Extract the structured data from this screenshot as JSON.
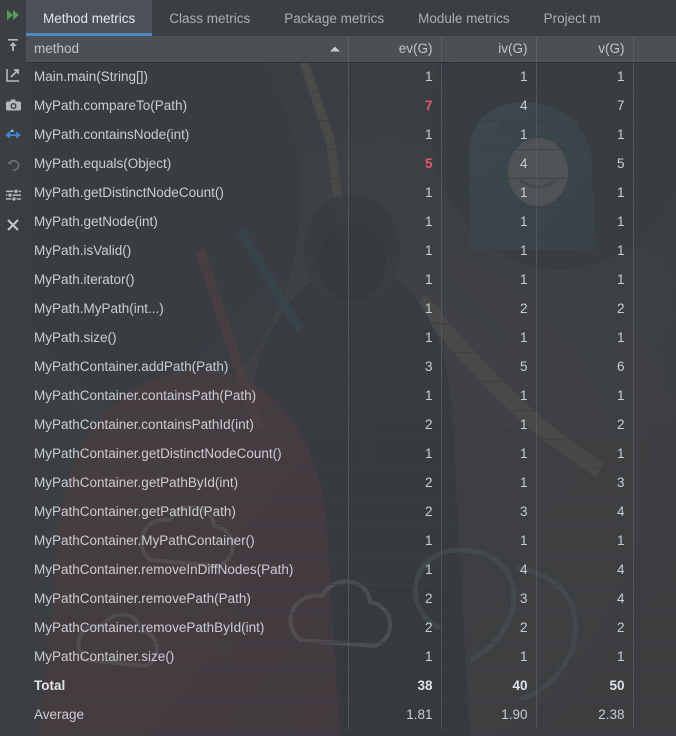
{
  "rail": {
    "items": [
      {
        "name": "fast-forward-icon",
        "title": "Expand"
      },
      {
        "name": "collapse-up-icon",
        "title": "Collapse"
      },
      {
        "name": "export-icon",
        "title": "Export"
      },
      {
        "name": "camera-icon",
        "title": "Snapshot"
      },
      {
        "name": "diff-arrows-icon",
        "title": "Compare"
      },
      {
        "name": "undo-icon",
        "title": "Undo"
      },
      {
        "name": "settings-sliders-icon",
        "title": "Settings"
      },
      {
        "name": "close-icon",
        "title": "Close"
      }
    ]
  },
  "tabs": [
    {
      "label": "Method metrics",
      "active": true
    },
    {
      "label": "Class metrics",
      "active": false
    },
    {
      "label": "Package metrics",
      "active": false
    },
    {
      "label": "Module metrics",
      "active": false
    },
    {
      "label": "Project m",
      "active": false
    }
  ],
  "table": {
    "columns": [
      "method",
      "ev(G)",
      "iv(G)",
      "v(G)"
    ],
    "sort": {
      "column": "method",
      "direction": "ascending"
    },
    "rows": [
      {
        "method": "Main.main(String[])",
        "ev": "1",
        "iv": "1",
        "v": "1"
      },
      {
        "method": "MyPath.compareTo(Path)",
        "ev": "7",
        "iv": "4",
        "v": "7",
        "ev_hot": true
      },
      {
        "method": "MyPath.containsNode(int)",
        "ev": "1",
        "iv": "1",
        "v": "1"
      },
      {
        "method": "MyPath.equals(Object)",
        "ev": "5",
        "iv": "4",
        "v": "5",
        "ev_hot": true
      },
      {
        "method": "MyPath.getDistinctNodeCount()",
        "ev": "1",
        "iv": "1",
        "v": "1"
      },
      {
        "method": "MyPath.getNode(int)",
        "ev": "1",
        "iv": "1",
        "v": "1"
      },
      {
        "method": "MyPath.isValid()",
        "ev": "1",
        "iv": "1",
        "v": "1"
      },
      {
        "method": "MyPath.iterator()",
        "ev": "1",
        "iv": "1",
        "v": "1"
      },
      {
        "method": "MyPath.MyPath(int...)",
        "ev": "1",
        "iv": "2",
        "v": "2"
      },
      {
        "method": "MyPath.size()",
        "ev": "1",
        "iv": "1",
        "v": "1"
      },
      {
        "method": "MyPathContainer.addPath(Path)",
        "ev": "3",
        "iv": "5",
        "v": "6"
      },
      {
        "method": "MyPathContainer.containsPath(Path)",
        "ev": "1",
        "iv": "1",
        "v": "1"
      },
      {
        "method": "MyPathContainer.containsPathId(int)",
        "ev": "2",
        "iv": "1",
        "v": "2"
      },
      {
        "method": "MyPathContainer.getDistinctNodeCount()",
        "ev": "1",
        "iv": "1",
        "v": "1"
      },
      {
        "method": "MyPathContainer.getPathById(int)",
        "ev": "2",
        "iv": "1",
        "v": "3"
      },
      {
        "method": "MyPathContainer.getPathId(Path)",
        "ev": "2",
        "iv": "3",
        "v": "4"
      },
      {
        "method": "MyPathContainer.MyPathContainer()",
        "ev": "1",
        "iv": "1",
        "v": "1"
      },
      {
        "method": "MyPathContainer.removeInDiffNodes(Path)",
        "ev": "1",
        "iv": "4",
        "v": "4"
      },
      {
        "method": "MyPathContainer.removePath(Path)",
        "ev": "2",
        "iv": "3",
        "v": "4"
      },
      {
        "method": "MyPathContainer.removePathById(int)",
        "ev": "2",
        "iv": "2",
        "v": "2"
      },
      {
        "method": "MyPathContainer.size()",
        "ev": "1",
        "iv": "1",
        "v": "1"
      }
    ],
    "summary": [
      {
        "label": "Total",
        "ev": "38",
        "iv": "40",
        "v": "50",
        "bold": true
      },
      {
        "label": "Average",
        "ev": "1.81",
        "iv": "1.90",
        "v": "2.38",
        "bold": false
      }
    ]
  },
  "colors": {
    "accent": "#4a88c7",
    "hot_value": "#e8566b",
    "panel_bg": "#3c3f41",
    "header_bg": "#4c5054",
    "active_tab_bg": "#4b5059",
    "text": "#c9ced2"
  }
}
